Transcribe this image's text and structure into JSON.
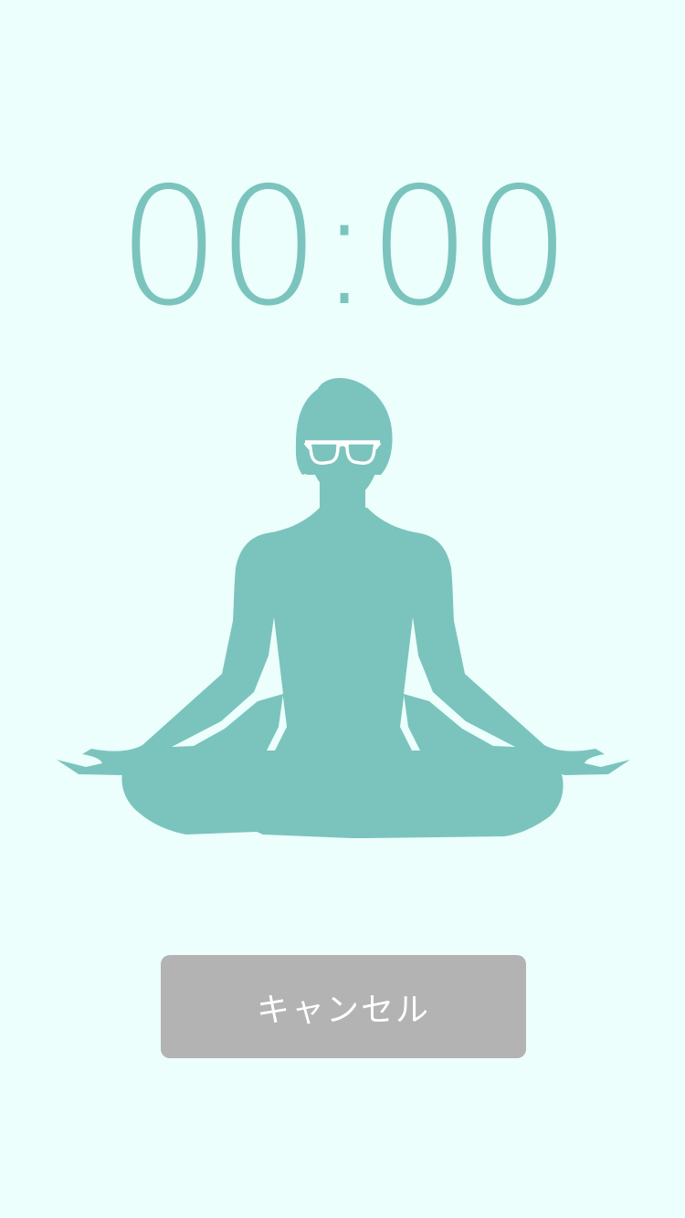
{
  "timer": {
    "display": "00:00"
  },
  "illustration": {
    "name": "meditating-person-icon",
    "color": "#7bc4bd"
  },
  "actions": {
    "cancel_label": "キャンセル"
  },
  "colors": {
    "background": "#ecfffc",
    "accent": "#7bc4bd",
    "button": "#b3b3b3",
    "button_text": "#ffffff"
  }
}
